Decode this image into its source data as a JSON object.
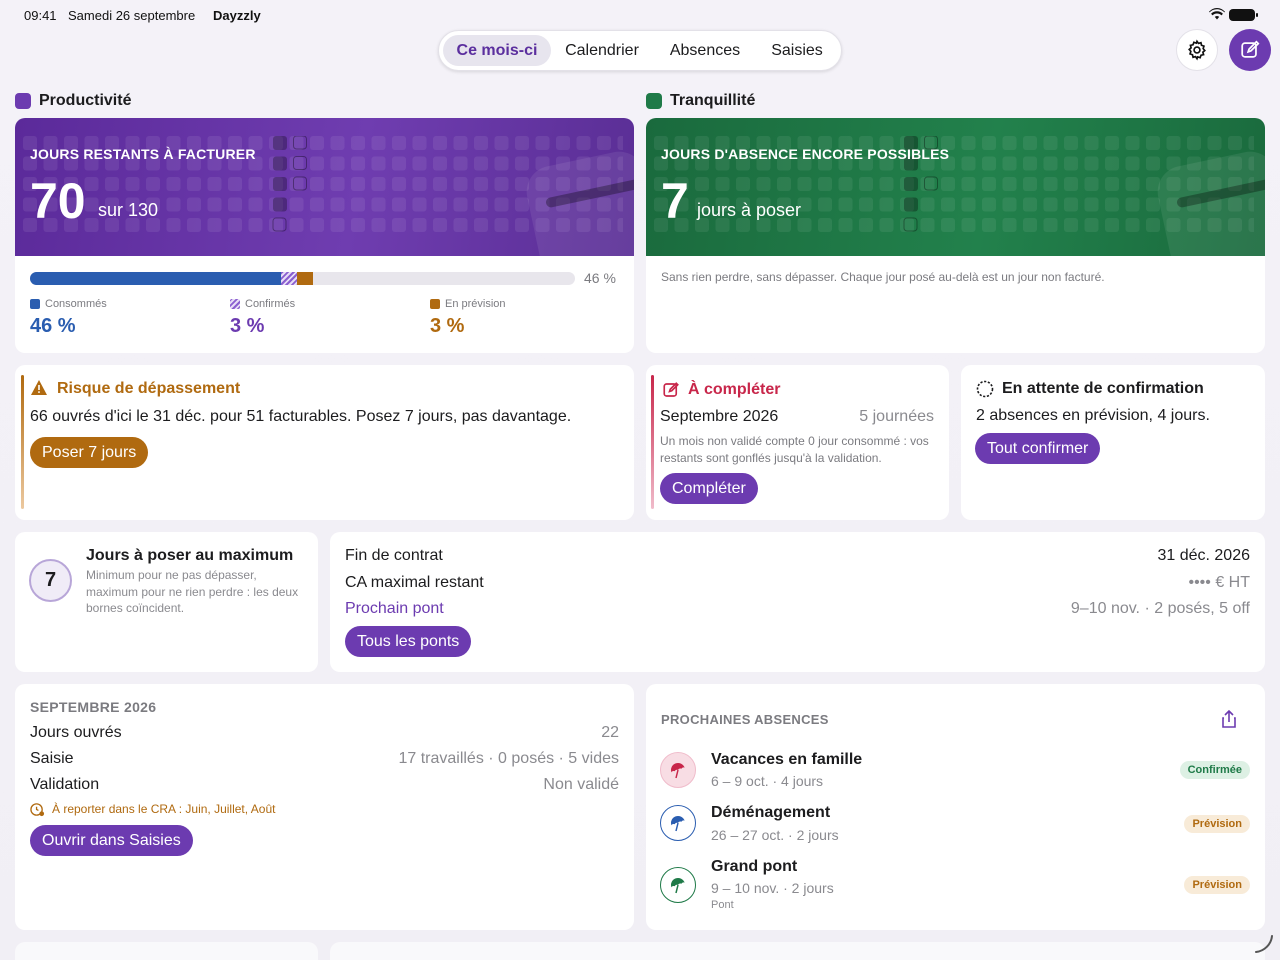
{
  "status": {
    "time": "09:41",
    "date": "Samedi 26 septembre",
    "app": "Dayzzly"
  },
  "tabs": [
    {
      "label": "Ce mois-ci",
      "active": true
    },
    {
      "label": "Calendrier"
    },
    {
      "label": "Absences"
    },
    {
      "label": "Saisies"
    }
  ],
  "icons": {
    "settings": "gear-icon",
    "compose": "compose-icon"
  },
  "colors": {
    "purple": "#6c3bb0",
    "green": "#1f7a48",
    "blue": "#2a5db0",
    "amber": "#b06a10",
    "red": "#c8264a"
  },
  "productivity": {
    "section": "Productivité",
    "label": "JOURS RESTANTS À FACTURER",
    "value": "70",
    "suffix": "sur 130",
    "progress_label": "46 %",
    "progress": {
      "consumed": 0.46,
      "confirmed": 0.03,
      "forecast": 0.03
    },
    "legend": [
      {
        "label": "Consommés",
        "value": "46 %"
      },
      {
        "label": "Confirmés",
        "value": "3 %"
      },
      {
        "label": "En prévision",
        "value": "3 %"
      }
    ]
  },
  "tranquility": {
    "section": "Tranquillité",
    "label": "JOURS D'ABSENCE ENCORE POSSIBLES",
    "value": "7",
    "suffix": "jours à poser",
    "note": "Sans rien perdre, sans dépasser. Chaque jour posé au-delà est un jour non facturé."
  },
  "risk": {
    "title": "Risque de dépassement",
    "text": "66 ouvrés d'ici le 31 déc. pour 51 facturables. Posez 7 jours, pas davantage.",
    "button": "Poser 7 jours"
  },
  "complete": {
    "title": "À compléter",
    "month": "Septembre 2026",
    "days": "5 journées",
    "note": "Un mois non validé compte 0 jour consommé : vos restants sont gonflés jusqu'à la validation.",
    "button": "Compléter"
  },
  "pending": {
    "title": "En attente de confirmation",
    "text": "2 absences en prévision, 4 jours.",
    "button": "Tout confirmer"
  },
  "maxdays": {
    "value": "7",
    "title": "Jours à poser au maximum",
    "text": "Minimum pour ne pas dépasser, maximum pour ne rien perdre : les deux bornes coïncident."
  },
  "contract": {
    "end_label": "Fin de contrat",
    "end_value": "31 déc. 2026",
    "ca_label": "CA maximal restant",
    "ca_value": "•••• € HT",
    "bridge_label": "Prochain pont",
    "bridge_value": "9–10 nov. · 2 posés, 5 off",
    "button": "Tous les ponts"
  },
  "month": {
    "title": "SEPTEMBRE 2026",
    "rows": [
      {
        "label": "Jours ouvrés",
        "value": "22"
      },
      {
        "label": "Saisie",
        "value": "17 travaillés · 0 posés · 5 vides"
      },
      {
        "label": "Validation",
        "value": "Non validé"
      }
    ],
    "report": "À reporter dans le CRA : Juin, Juillet, Août",
    "button": "Ouvrir dans Saisies"
  },
  "upcoming": {
    "title": "PROCHAINES ABSENCES",
    "items": [
      {
        "name": "Vacances en famille",
        "dates": "6 – 9 oct. · 4 jours",
        "badge": "Confirmée",
        "tag": ""
      },
      {
        "name": "Déménagement",
        "dates": "26 – 27 oct. · 2 jours",
        "badge": "Prévision",
        "tag": ""
      },
      {
        "name": "Grand pont",
        "dates": "9 – 10 nov. · 2 jours",
        "badge": "Prévision",
        "tag": "Pont"
      }
    ]
  }
}
